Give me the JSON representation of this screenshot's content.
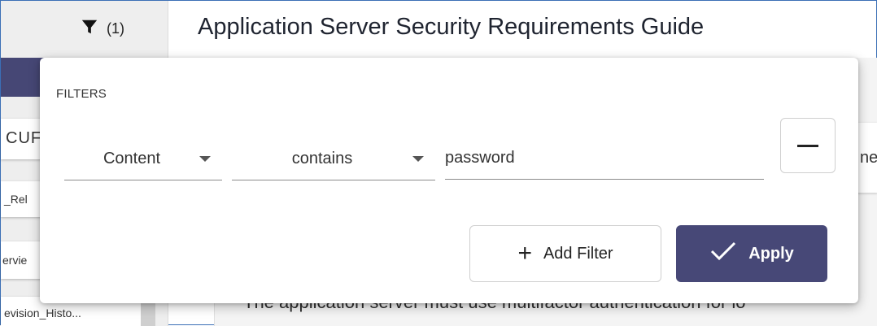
{
  "sidebar": {
    "filter_count": "(1)",
    "items": [
      {
        "label": "CUF"
      },
      {
        "label": "_Rel"
      },
      {
        "label": "ervie"
      },
      {
        "label": "evision_Histo..."
      }
    ]
  },
  "main": {
    "title": "Application Server Security Requirements Guide",
    "card_fragment": "ne",
    "body_text": "The application server must use multifactor authentication for lo"
  },
  "filters_popover": {
    "heading": "FILTERS",
    "field_select": "Content",
    "operator_select": "contains",
    "value": "password",
    "add_filter_label": "Add Filter",
    "apply_label": "Apply"
  },
  "colors": {
    "accent": "#474877",
    "sidebar_bg": "#eeeeee"
  },
  "icons": [
    "filter-icon",
    "minus-icon",
    "plus-icon",
    "checkmark-icon",
    "dropdown-caret-icon"
  ]
}
